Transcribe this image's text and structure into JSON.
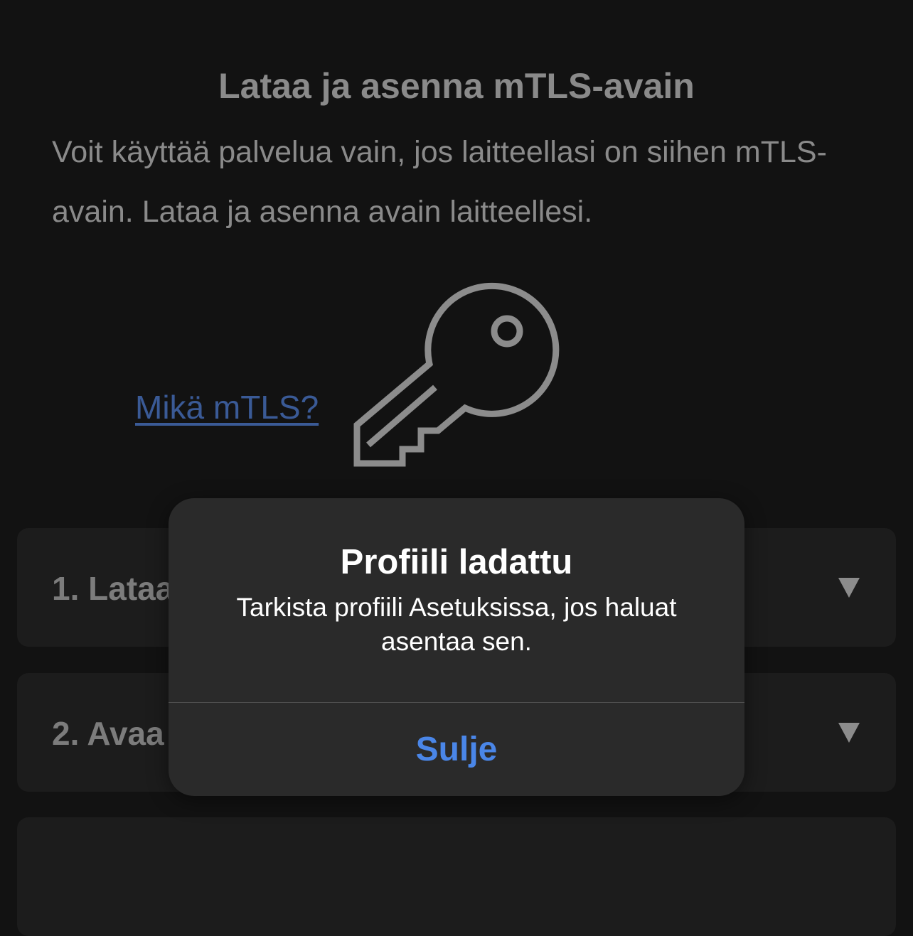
{
  "page": {
    "title": "Lataa ja asenna mTLS-avain",
    "intro": "Voit käyttää palvelua vain, jos laitteellasi on siihen mTLS-avain. Lataa ja asenna avain laitteellesi.",
    "link_text": "Mikä mTLS?",
    "illustration_icon": "key-icon"
  },
  "steps": [
    {
      "label": "1. Lataa",
      "expand_icon": "triangle-down-icon"
    },
    {
      "label": "2. Avaa",
      "expand_icon": "triangle-down-icon"
    }
  ],
  "dialog": {
    "title": "Profiili ladattu",
    "message": "Tarkista profiili Asetuksissa, jos haluat asentaa sen.",
    "button_label": "Sulje"
  },
  "colors": {
    "background": "#121212",
    "muted_text": "#8a8a8a",
    "link": "#3a5a96",
    "dialog_background": "#2a2a2a",
    "dialog_action": "#4a86e8"
  }
}
